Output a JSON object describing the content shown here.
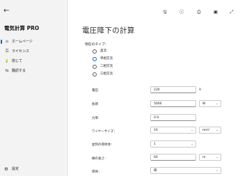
{
  "app": {
    "title": "電気計算 PRO"
  },
  "sidebar": {
    "back_icon": "←",
    "items": [
      {
        "label": "ホームページ",
        "icon": "home-icon",
        "glyph": "⌂",
        "active": true
      },
      {
        "label": "ライセンス",
        "icon": "key-icon",
        "glyph": "⚿",
        "active": false
      },
      {
        "label": "閉じて",
        "icon": "lightbulb-icon",
        "glyph": "💡",
        "active": false
      },
      {
        "label": "翻訳する",
        "icon": "translate-icon",
        "glyph": "⇆",
        "active": false
      }
    ],
    "settings_label": "設定",
    "settings_glyph": "⚙"
  },
  "toolbar": {
    "save_glyph": "🖫",
    "info_glyph": "ⓘ",
    "print_glyph": "⎙",
    "image_glyph": "▣",
    "fullscreen_glyph": "⤢"
  },
  "page": {
    "title": "電圧降下の計算",
    "current_type_label": "現在のタイプ：",
    "current_types": [
      {
        "label": "直流",
        "checked": false
      },
      {
        "label": "単相交流",
        "checked": true
      },
      {
        "label": "二相交流",
        "checked": false
      },
      {
        "label": "三相交流",
        "checked": false
      }
    ]
  },
  "form": {
    "voltage": {
      "label": "電圧:",
      "value": "230",
      "unit": "V"
    },
    "load": {
      "label": "負荷",
      "value": "5000",
      "unit": "W"
    },
    "power_factor": {
      "label": "力率:",
      "value": "0.9"
    },
    "wire_size": {
      "label": "ワイヤーサイズ：",
      "value": "10",
      "unit": "mm²"
    },
    "parallel_conductors": {
      "label": "並列の導体体：",
      "value": "1"
    },
    "wire_length": {
      "label": "線の長さ：",
      "value": "60",
      "unit": "m"
    },
    "conductor": {
      "label": "導体：",
      "value": "銅"
    }
  },
  "colors": {
    "accent": "#0067c0",
    "sidebar_bg": "#f3f3f3"
  }
}
